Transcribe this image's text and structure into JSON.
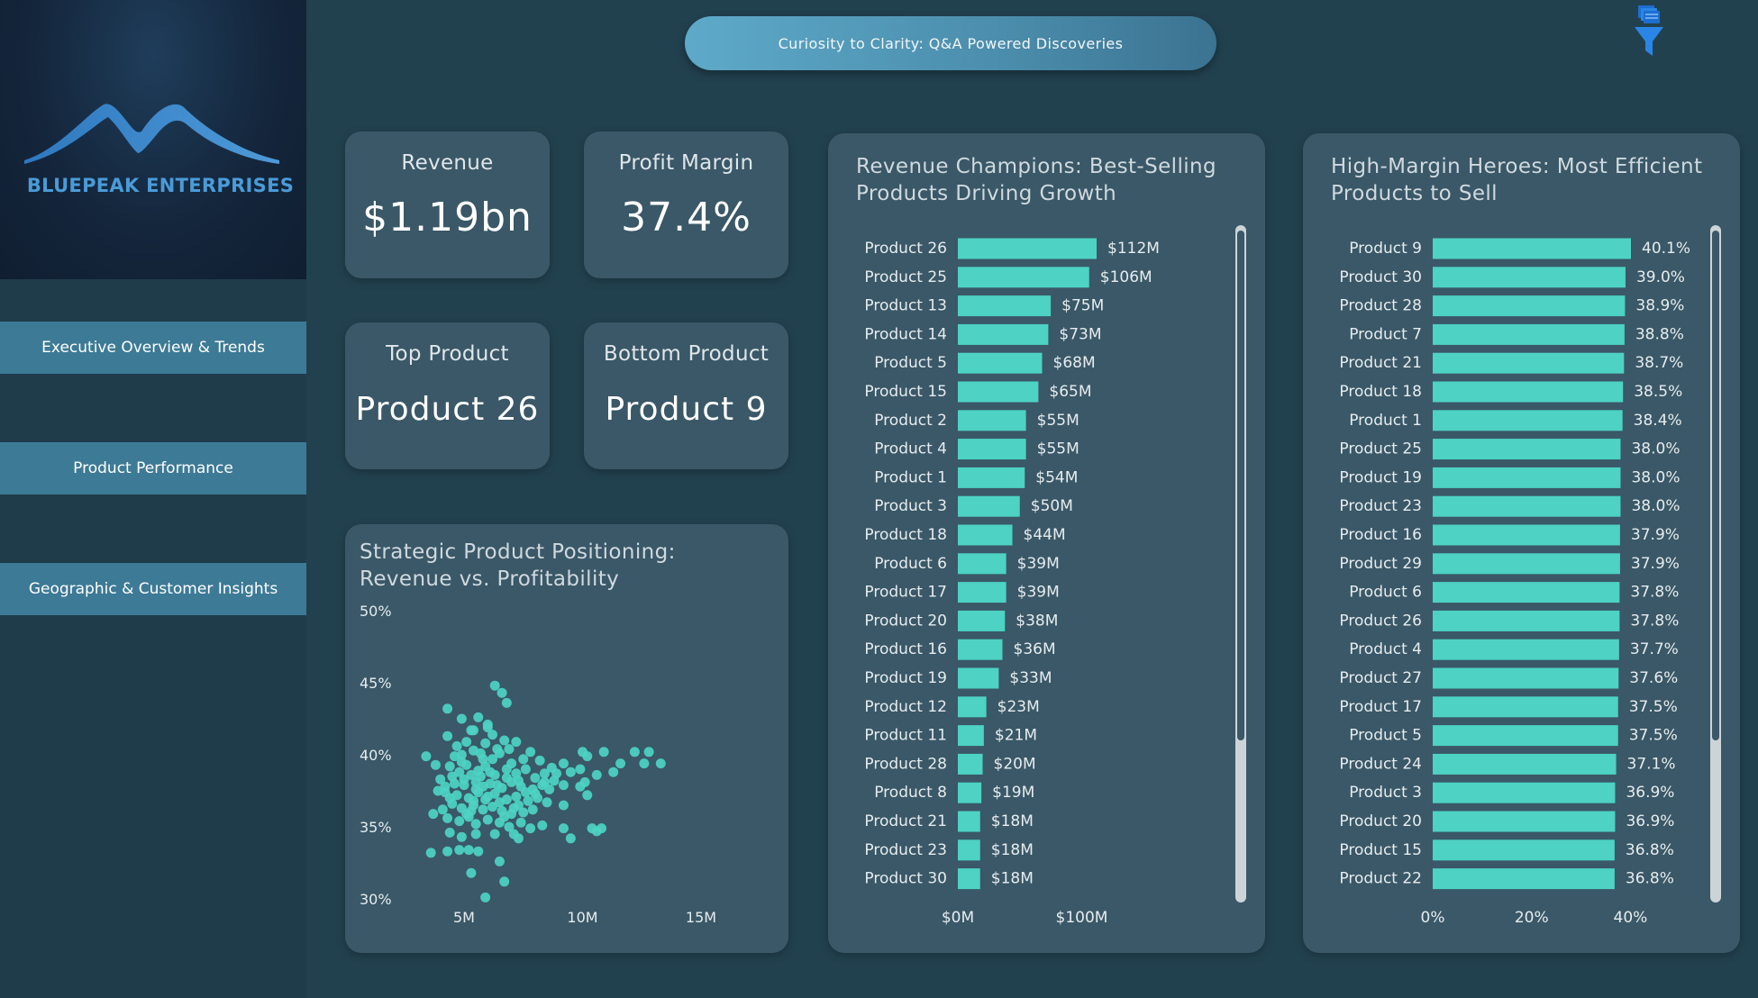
{
  "brand": {
    "name": "BLUEPEAK ENTERPRISES",
    "logo_icon": "mountain-peaks-logo"
  },
  "nav": {
    "items": [
      {
        "label": "Executive Overview & Trends"
      },
      {
        "label": "Product Performance"
      },
      {
        "label": "Geographic & Customer Insights"
      }
    ]
  },
  "header": {
    "title": "Curiosity to Clarity: Q&A Powered Discoveries",
    "filter_icon": "filter-funnel-icon"
  },
  "kpis": {
    "revenue": {
      "label": "Revenue",
      "value": "$1.19bn"
    },
    "margin": {
      "label": "Profit Margin",
      "value": "37.4%"
    },
    "top": {
      "label": "Top Product",
      "value": "Product 26"
    },
    "bottom": {
      "label": "Bottom Product",
      "value": "Product 9"
    }
  },
  "colors": {
    "bar": "#4dd2c3",
    "point": "#4dd2c3",
    "card": "#3a5867",
    "background": "#22414f",
    "nav": "#3d7a96",
    "brand": "#4a9bd8"
  },
  "chart_data": [
    {
      "type": "bar",
      "orientation": "horizontal",
      "title": "Revenue Champions: Best-Selling Products Driving Growth",
      "categories": [
        "Product 26",
        "Product 25",
        "Product 13",
        "Product 14",
        "Product 5",
        "Product 15",
        "Product 2",
        "Product 4",
        "Product 1",
        "Product 3",
        "Product 18",
        "Product 6",
        "Product 17",
        "Product 20",
        "Product 16",
        "Product 19",
        "Product 12",
        "Product 11",
        "Product 28",
        "Product 8",
        "Product 21",
        "Product 23",
        "Product 30"
      ],
      "values": [
        112,
        106,
        75,
        73,
        68,
        65,
        55,
        55,
        54,
        50,
        44,
        39,
        39,
        38,
        36,
        33,
        23,
        21,
        20,
        19,
        18,
        18,
        18
      ],
      "value_labels": [
        "$112M",
        "$106M",
        "$75M",
        "$73M",
        "$68M",
        "$65M",
        "$55M",
        "$55M",
        "$54M",
        "$50M",
        "$44M",
        "$39M",
        "$39M",
        "$38M",
        "$36M",
        "$33M",
        "$23M",
        "$21M",
        "$20M",
        "$19M",
        "$18M",
        "$18M",
        "$18M"
      ],
      "xlim": [
        0,
        160
      ],
      "xticks": [
        0,
        100
      ],
      "xtick_labels": [
        "$0M",
        "$100M"
      ],
      "scrollbar": true
    },
    {
      "type": "bar",
      "orientation": "horizontal",
      "title": "High-Margin Heroes: Most Efficient Products to Sell",
      "categories": [
        "Product 9",
        "Product 30",
        "Product 28",
        "Product 7",
        "Product 21",
        "Product 18",
        "Product 1",
        "Product 25",
        "Product 19",
        "Product 23",
        "Product 16",
        "Product 29",
        "Product 6",
        "Product 26",
        "Product 4",
        "Product 27",
        "Product 17",
        "Product 5",
        "Product 24",
        "Product 3",
        "Product 20",
        "Product 15",
        "Product 22"
      ],
      "values": [
        40.1,
        39.0,
        38.9,
        38.8,
        38.7,
        38.5,
        38.4,
        38.0,
        38.0,
        38.0,
        37.9,
        37.9,
        37.8,
        37.8,
        37.7,
        37.6,
        37.5,
        37.5,
        37.1,
        36.9,
        36.9,
        36.8,
        36.8
      ],
      "value_labels": [
        "40.1%",
        "39.0%",
        "38.9%",
        "38.8%",
        "38.7%",
        "38.5%",
        "38.4%",
        "38.0%",
        "38.0%",
        "38.0%",
        "37.9%",
        "37.9%",
        "37.8%",
        "37.8%",
        "37.7%",
        "37.6%",
        "37.5%",
        "37.5%",
        "37.1%",
        "36.9%",
        "36.9%",
        "36.8%",
        "36.8%"
      ],
      "xlim": [
        0,
        40.1
      ],
      "xticks": [
        0,
        20,
        40
      ],
      "xtick_labels": [
        "0%",
        "20%",
        "40%"
      ],
      "scrollbar": true
    },
    {
      "type": "scatter",
      "title": "Strategic Product Positioning: Revenue vs. Profitability",
      "xlim": [
        0,
        15
      ],
      "ylim": [
        30,
        50
      ],
      "xticks": [
        5,
        10,
        15
      ],
      "xtick_labels": [
        "5M",
        "10M",
        "15M"
      ],
      "yticks": [
        30,
        35,
        40,
        45,
        50
      ],
      "ytick_labels": [
        "30%",
        "35%",
        "40%",
        "45%",
        "50%"
      ],
      "points": [
        [
          6.3,
          44.8
        ],
        [
          6.6,
          44.3
        ],
        [
          6.8,
          43.6
        ],
        [
          4.3,
          43.2
        ],
        [
          4.9,
          42.5
        ],
        [
          6.0,
          41.9
        ],
        [
          5.4,
          41.7
        ],
        [
          4.3,
          41.3
        ],
        [
          6.2,
          41.4
        ],
        [
          5.9,
          40.8
        ],
        [
          6.7,
          41.0
        ],
        [
          7.2,
          40.9
        ],
        [
          5.7,
          40.1
        ],
        [
          4.6,
          39.9
        ],
        [
          4.9,
          40.0
        ],
        [
          5.4,
          40.3
        ],
        [
          6.2,
          39.7
        ],
        [
          6.5,
          40.1
        ],
        [
          10.0,
          40.2
        ],
        [
          10.2,
          39.9
        ],
        [
          10.9,
          40.2
        ],
        [
          12.2,
          40.2
        ],
        [
          12.6,
          39.4
        ],
        [
          3.4,
          39.9
        ],
        [
          3.8,
          39.3
        ],
        [
          4.4,
          39.2
        ],
        [
          4.8,
          38.8
        ],
        [
          5.1,
          39.3
        ],
        [
          5.6,
          38.9
        ],
        [
          5.9,
          39.2
        ],
        [
          6.3,
          38.6
        ],
        [
          6.8,
          39.0
        ],
        [
          7.2,
          38.7
        ],
        [
          7.6,
          39.0
        ],
        [
          8.0,
          38.4
        ],
        [
          8.4,
          38.7
        ],
        [
          8.7,
          39.1
        ],
        [
          9.2,
          39.4
        ],
        [
          9.5,
          38.8
        ],
        [
          9.9,
          39.0
        ],
        [
          8.8,
          38.2
        ],
        [
          9.2,
          37.9
        ],
        [
          4.0,
          38.3
        ],
        [
          4.6,
          38.0
        ],
        [
          5.0,
          37.9
        ],
        [
          5.5,
          38.1
        ],
        [
          5.8,
          37.8
        ],
        [
          6.1,
          38.0
        ],
        [
          6.6,
          37.7
        ],
        [
          7.0,
          38.1
        ],
        [
          7.4,
          37.8
        ],
        [
          7.9,
          37.6
        ],
        [
          8.3,
          37.9
        ],
        [
          4.2,
          37.4
        ],
        [
          4.7,
          37.2
        ],
        [
          5.2,
          37.0
        ],
        [
          5.6,
          37.4
        ],
        [
          6.0,
          37.1
        ],
        [
          6.3,
          37.3
        ],
        [
          6.8,
          36.9
        ],
        [
          7.2,
          37.1
        ],
        [
          7.7,
          36.8
        ],
        [
          8.1,
          37.0
        ],
        [
          8.5,
          36.7
        ],
        [
          10.2,
          37.2
        ],
        [
          4.5,
          36.6
        ],
        [
          4.9,
          36.3
        ],
        [
          5.4,
          36.5
        ],
        [
          5.8,
          36.2
        ],
        [
          6.2,
          36.4
        ],
        [
          6.6,
          36.1
        ],
        [
          7.1,
          36.3
        ],
        [
          7.5,
          36.0
        ],
        [
          7.9,
          36.2
        ],
        [
          3.7,
          35.9
        ],
        [
          4.3,
          35.6
        ],
        [
          4.8,
          35.4
        ],
        [
          5.2,
          35.7
        ],
        [
          5.5,
          35.2
        ],
        [
          6.0,
          35.5
        ],
        [
          6.5,
          35.3
        ],
        [
          6.9,
          35.0
        ],
        [
          7.4,
          35.3
        ],
        [
          7.8,
          34.9
        ],
        [
          8.3,
          35.1
        ],
        [
          9.2,
          34.9
        ],
        [
          4.4,
          34.6
        ],
        [
          4.9,
          34.3
        ],
        [
          5.5,
          34.5
        ],
        [
          6.3,
          34.5
        ],
        [
          7.1,
          34.5
        ],
        [
          7.3,
          34.2
        ],
        [
          9.5,
          34.2
        ],
        [
          10.6,
          34.7
        ],
        [
          10.8,
          34.9
        ],
        [
          10.4,
          34.9
        ],
        [
          5.2,
          33.4
        ],
        [
          4.8,
          33.4
        ],
        [
          5.6,
          33.3
        ],
        [
          4.3,
          33.3
        ],
        [
          3.6,
          33.2
        ],
        [
          6.5,
          32.6
        ],
        [
          5.3,
          31.8
        ],
        [
          6.7,
          31.2
        ],
        [
          5.9,
          30.1
        ],
        [
          12.8,
          40.2
        ],
        [
          13.3,
          39.4
        ],
        [
          11.3,
          38.8
        ],
        [
          11.6,
          39.4
        ],
        [
          10.6,
          38.6
        ],
        [
          9.9,
          37.8
        ],
        [
          10.1,
          38.1
        ],
        [
          5.1,
          40.9
        ],
        [
          5.3,
          41.7
        ],
        [
          6.0,
          42.1
        ],
        [
          4.9,
          39.5
        ],
        [
          5.3,
          38.6
        ],
        [
          5.0,
          38.3
        ],
        [
          5.7,
          38.5
        ],
        [
          6.1,
          38.8
        ],
        [
          4.5,
          38.5
        ],
        [
          4.2,
          37.8
        ],
        [
          4.4,
          37.0
        ],
        [
          5.4,
          36.8
        ],
        [
          5.9,
          36.9
        ],
        [
          6.5,
          36.7
        ],
        [
          3.9,
          37.5
        ],
        [
          4.1,
          36.2
        ],
        [
          5.1,
          35.9
        ],
        [
          6.7,
          35.7
        ],
        [
          7.0,
          35.9
        ],
        [
          7.3,
          36.5
        ],
        [
          7.6,
          37.4
        ],
        [
          8.0,
          37.3
        ],
        [
          8.4,
          38.1
        ],
        [
          8.9,
          38.7
        ],
        [
          8.6,
          37.6
        ],
        [
          9.2,
          36.5
        ],
        [
          7.0,
          39.4
        ],
        [
          7.5,
          39.7
        ],
        [
          7.8,
          40.2
        ],
        [
          8.2,
          39.6
        ],
        [
          6.4,
          40.4
        ],
        [
          6.9,
          40.4
        ],
        [
          5.6,
          42.6
        ],
        [
          5.8,
          39.7
        ],
        [
          4.7,
          40.6
        ],
        [
          5.5,
          37.6
        ],
        [
          6.4,
          37.9
        ],
        [
          6.8,
          38.4
        ],
        [
          7.3,
          38.2
        ],
        [
          5.3,
          36.1
        ]
      ],
      "legend": "none"
    }
  ]
}
